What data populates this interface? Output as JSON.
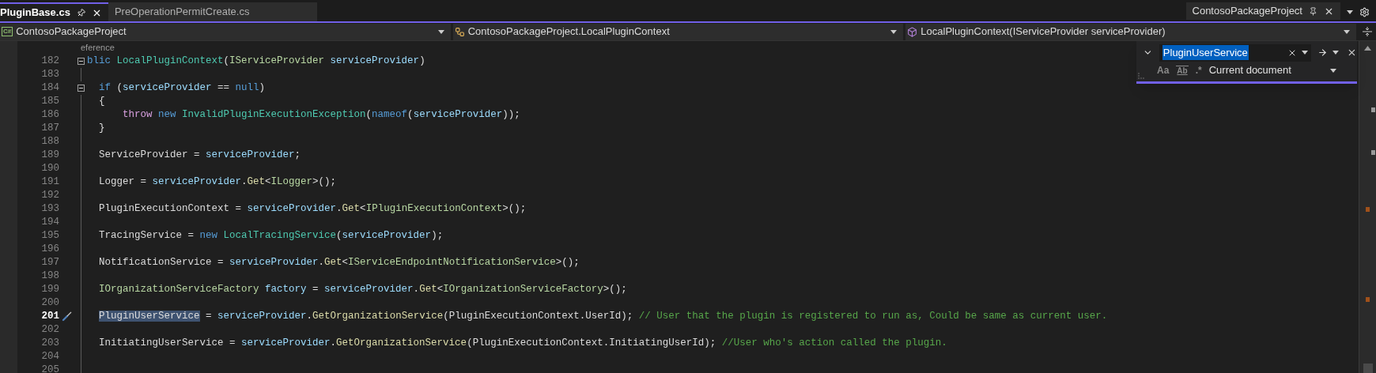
{
  "document_tabs": [
    {
      "label": "PluginBase.cs",
      "selected": true
    },
    {
      "label": "PreOperationPermitCreate.cs",
      "selected": false
    }
  ],
  "tool_tab": {
    "label": "ContosoPackageProject"
  },
  "navigation": [
    {
      "kind": "project",
      "icon_text": "C#",
      "label": "ContosoPackageProject"
    },
    {
      "kind": "class",
      "label": "ContosoPackageProject.LocalPluginContext"
    },
    {
      "kind": "member",
      "label": "LocalPluginContext(IServiceProvider serviceProvider)"
    }
  ],
  "codelens": "eference",
  "lines": [
    {
      "number": "182",
      "current": false,
      "expanded": true,
      "tokens": [
        {
          "text": "blic",
          "kind": "keyword"
        },
        {
          "text": " LocalPluginContext",
          "kind": "type"
        },
        {
          "text": "(",
          "kind": "plain"
        },
        {
          "text": "IServiceProvider",
          "kind": "interface"
        },
        {
          "text": " serviceProvider",
          "kind": "param"
        },
        {
          "text": ")",
          "kind": "plain"
        }
      ]
    },
    {
      "number": "183",
      "current": false
    },
    {
      "number": "184",
      "current": false,
      "expanded": true,
      "tokens": [
        {
          "text": "  if",
          "kind": "keyword"
        },
        {
          "text": " (",
          "kind": "plain"
        },
        {
          "text": "serviceProvider",
          "kind": "param"
        },
        {
          "text": " == ",
          "kind": "plain"
        },
        {
          "text": "null",
          "kind": "keyword"
        },
        {
          "text": ")",
          "kind": "plain"
        }
      ]
    },
    {
      "number": "185",
      "current": false,
      "tokens": [
        {
          "text": "  {",
          "kind": "plain"
        }
      ]
    },
    {
      "number": "186",
      "current": false,
      "tokens": [
        {
          "text": "      throw",
          "kind": "control"
        },
        {
          "text": " new",
          "kind": "keyword"
        },
        {
          "text": " InvalidPluginExecutionException",
          "kind": "type"
        },
        {
          "text": "(",
          "kind": "plain"
        },
        {
          "text": "nameof",
          "kind": "keyword"
        },
        {
          "text": "(",
          "kind": "plain"
        },
        {
          "text": "serviceProvider",
          "kind": "param"
        },
        {
          "text": "));",
          "kind": "plain"
        }
      ]
    },
    {
      "number": "187",
      "current": false,
      "tokens": [
        {
          "text": "  }",
          "kind": "plain"
        }
      ]
    },
    {
      "number": "188",
      "current": false
    },
    {
      "number": "189",
      "current": false,
      "tokens": [
        {
          "text": "  ServiceProvider = ",
          "kind": "plain"
        },
        {
          "text": "serviceProvider",
          "kind": "param"
        },
        {
          "text": ";",
          "kind": "plain"
        }
      ]
    },
    {
      "number": "190",
      "current": false
    },
    {
      "number": "191",
      "current": false,
      "tokens": [
        {
          "text": "  Logger = ",
          "kind": "plain"
        },
        {
          "text": "serviceProvider",
          "kind": "param"
        },
        {
          "text": ".",
          "kind": "plain"
        },
        {
          "text": "Get",
          "kind": "method"
        },
        {
          "text": "<",
          "kind": "plain"
        },
        {
          "text": "ILogger",
          "kind": "interface"
        },
        {
          "text": ">();",
          "kind": "plain"
        }
      ]
    },
    {
      "number": "192",
      "current": false
    },
    {
      "number": "193",
      "current": false,
      "tokens": [
        {
          "text": "  PluginExecutionContext = ",
          "kind": "plain"
        },
        {
          "text": "serviceProvider",
          "kind": "param"
        },
        {
          "text": ".",
          "kind": "plain"
        },
        {
          "text": "Get",
          "kind": "method"
        },
        {
          "text": "<",
          "kind": "plain"
        },
        {
          "text": "IPluginExecutionContext",
          "kind": "interface"
        },
        {
          "text": ">();",
          "kind": "plain"
        }
      ]
    },
    {
      "number": "194",
      "current": false
    },
    {
      "number": "195",
      "current": false,
      "tokens": [
        {
          "text": "  TracingService = ",
          "kind": "plain"
        },
        {
          "text": "new",
          "kind": "keyword"
        },
        {
          "text": " LocalTracingService",
          "kind": "type"
        },
        {
          "text": "(",
          "kind": "plain"
        },
        {
          "text": "serviceProvider",
          "kind": "param"
        },
        {
          "text": ");",
          "kind": "plain"
        }
      ]
    },
    {
      "number": "196",
      "current": false
    },
    {
      "number": "197",
      "current": false,
      "tokens": [
        {
          "text": "  NotificationService = ",
          "kind": "plain"
        },
        {
          "text": "serviceProvider",
          "kind": "param"
        },
        {
          "text": ".",
          "kind": "plain"
        },
        {
          "text": "Get",
          "kind": "method"
        },
        {
          "text": "<",
          "kind": "plain"
        },
        {
          "text": "IServiceEndpointNotificationService",
          "kind": "interface"
        },
        {
          "text": ">();",
          "kind": "plain"
        }
      ]
    },
    {
      "number": "198",
      "current": false
    },
    {
      "number": "199",
      "current": false,
      "tokens": [
        {
          "text": "  IOrganizationServiceFactory",
          "kind": "interface"
        },
        {
          "text": " factory",
          "kind": "param"
        },
        {
          "text": " = ",
          "kind": "plain"
        },
        {
          "text": "serviceProvider",
          "kind": "param"
        },
        {
          "text": ".",
          "kind": "plain"
        },
        {
          "text": "Get",
          "kind": "method"
        },
        {
          "text": "<",
          "kind": "plain"
        },
        {
          "text": "IOrganizationServiceFactory",
          "kind": "interface"
        },
        {
          "text": ">();",
          "kind": "plain"
        }
      ]
    },
    {
      "number": "200",
      "current": false
    },
    {
      "number": "201",
      "current": true,
      "tokens": [
        {
          "text": "  PluginUserService",
          "kind": "match"
        },
        {
          "text": " = ",
          "kind": "plain"
        },
        {
          "text": "serviceProvider",
          "kind": "param"
        },
        {
          "text": ".",
          "kind": "plain"
        },
        {
          "text": "GetOrganizationService",
          "kind": "method"
        },
        {
          "text": "(PluginExecutionContext.UserId); ",
          "kind": "plain"
        },
        {
          "text": "// User that the plugin is registered to run as, Could be same as current user.",
          "kind": "comment"
        }
      ]
    },
    {
      "number": "202",
      "current": false
    },
    {
      "number": "203",
      "current": false,
      "tokens": [
        {
          "text": "  InitiatingUserService = ",
          "kind": "plain"
        },
        {
          "text": "serviceProvider",
          "kind": "param"
        },
        {
          "text": ".",
          "kind": "plain"
        },
        {
          "text": "GetOrganizationService",
          "kind": "method"
        },
        {
          "text": "(PluginExecutionContext.InitiatingUserId); ",
          "kind": "plain"
        },
        {
          "text": "//User who's action called the plugin.",
          "kind": "comment"
        }
      ]
    },
    {
      "number": "204",
      "current": false
    },
    {
      "number": "205",
      "current": false
    }
  ],
  "find": {
    "query": "PluginUserService",
    "scope": "Current document",
    "options": [
      {
        "label": "Aa"
      },
      {
        "label": "Ab"
      },
      {
        "label": ".*"
      }
    ]
  }
}
